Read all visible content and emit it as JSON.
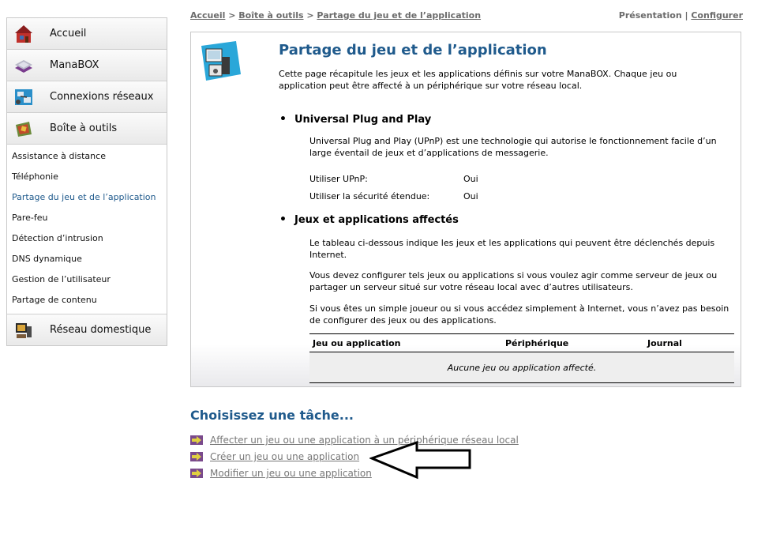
{
  "sidebar": {
    "categories": [
      {
        "label": "Accueil",
        "icon": "house-icon"
      },
      {
        "label": "ManaBOX",
        "icon": "modem-icon"
      },
      {
        "label": "Connexions réseaux",
        "icon": "network-icon"
      },
      {
        "label": "Boîte à outils",
        "icon": "toolbox-icon"
      }
    ],
    "subitems": [
      "Assistance à distance",
      "Téléphonie",
      "Partage du jeu et de l’application",
      "Pare-feu",
      "Détection d’intrusion",
      "DNS dynamique",
      "Gestion de l’utilisateur",
      "Partage de contenu"
    ],
    "last_category": {
      "label": "Réseau domestique",
      "icon": "home-network-icon"
    }
  },
  "breadcrumb": {
    "item1": "Accueil",
    "sep": " > ",
    "item2": "Boîte à outils",
    "item3": "Partage du jeu et de l’application"
  },
  "header_links": {
    "presentation": "Présentation",
    "separator": " | ",
    "configure": "Configurer"
  },
  "main": {
    "title": "Partage du jeu et de l’application",
    "intro": "Cette page récapitule les jeux et les applications définis sur votre ManaBOX. Chaque jeu ou application peut être affecté à un périphérique sur votre réseau local.",
    "upnp": {
      "heading": "Universal Plug and Play",
      "description": "Universal Plug and Play (UPnP) est une technologie qui autorise le fonctionnement facile d’un large éventail de jeux et d’applications de messagerie.",
      "use_upnp_label": "Utiliser UPnP:",
      "use_upnp_value": "Oui",
      "security_label": "Utiliser la sécurité étendue:",
      "security_value": "Oui"
    },
    "games": {
      "heading": "Jeux et applications affectés",
      "para1": "Le tableau ci-dessous indique les jeux et les applications qui peuvent être déclenchés depuis Internet.",
      "para2": "Vous devez configurer tels jeux ou applications si vous voulez agir comme serveur de jeux ou partager un serveur situé sur votre réseau local avec d’autres utilisateurs.",
      "para3": "Si vous êtes un simple joueur ou si vous accédez simplement à Internet, vous n’avez pas besoin de configurer des jeux ou des applications.",
      "table": {
        "headers": [
          "Jeu ou application",
          "Périphérique",
          "Journal"
        ],
        "empty": "Aucune jeu ou application affecté."
      }
    }
  },
  "tasks": {
    "title": "Choisissez une tâche...",
    "items": [
      "Affecter un jeu ou une application à un périphérique réseau local",
      "Créer un jeu ou une application",
      "Modifier un jeu ou une application"
    ]
  },
  "colors": {
    "accent": "#1f5a8c",
    "task_arrow": "#7a4a8c"
  }
}
